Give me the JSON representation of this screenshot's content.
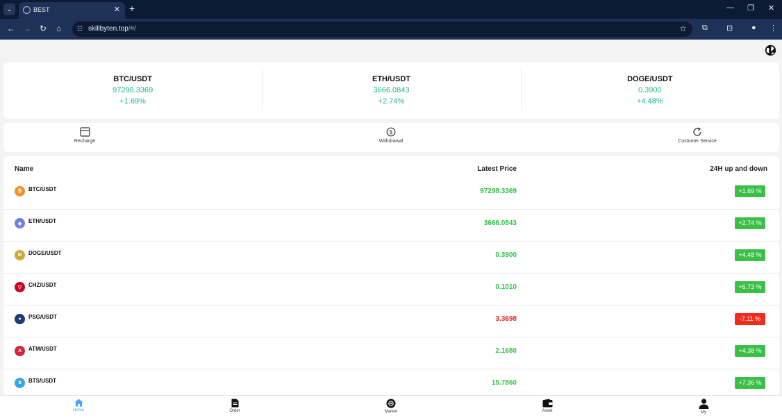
{
  "browser": {
    "tab_title": "BEST",
    "url_host": "skillbyten.top",
    "url_path": "/#/"
  },
  "tickers": [
    {
      "symbol": "BTC/USDT",
      "price": "97298.3369",
      "change": "+1.69%"
    },
    {
      "symbol": "ETH/USDT",
      "price": "3666.0843",
      "change": "+2.74%"
    },
    {
      "symbol": "DOGE/USDT",
      "price": "0.3900",
      "change": "+4.48%"
    }
  ],
  "quick_actions": {
    "recharge": "Recharge",
    "withdrawal": "Withdrawal",
    "customer_service": "Customer Service"
  },
  "market_list": {
    "headers": {
      "name": "Name",
      "latest_price": "Latest Price",
      "change_24h": "24H up and down"
    },
    "rows": [
      {
        "pair": "BTC/USDT",
        "price": "97298.3369",
        "change": "+1.69 %",
        "trend": "up",
        "icon": "bitcoin-icon",
        "icon_color": "#f2902f",
        "icon_glyph": "₿"
      },
      {
        "pair": "ETH/USDT",
        "price": "3666.0843",
        "change": "+2.74 %",
        "trend": "up",
        "icon": "ethereum-icon",
        "icon_color": "#6f7fe3",
        "icon_glyph": "◆"
      },
      {
        "pair": "DOGE/USDT",
        "price": "0.3900",
        "change": "+4.48 %",
        "trend": "up",
        "icon": "dogecoin-icon",
        "icon_color": "#c9a93b",
        "icon_glyph": "Đ"
      },
      {
        "pair": "CHZ/USDT",
        "price": "0.1010",
        "change": "+6.73 %",
        "trend": "up",
        "icon": "chiliz-icon",
        "icon_color": "#cd0124",
        "icon_glyph": "▽"
      },
      {
        "pair": "PSG/USDT",
        "price": "3.3698",
        "change": "-7.11 %",
        "trend": "down",
        "icon": "psg-icon",
        "icon_color": "#1f3b7a",
        "icon_glyph": "●"
      },
      {
        "pair": "ATM/USDT",
        "price": "2.1680",
        "change": "+4.38 %",
        "trend": "up",
        "icon": "atletico-icon",
        "icon_color": "#d8223a",
        "icon_glyph": "A"
      },
      {
        "pair": "BTS/USDT",
        "price": "15.7860",
        "change": "+7.36 %",
        "trend": "up",
        "icon": "bitshares-icon",
        "icon_color": "#35a7e0",
        "icon_glyph": "b"
      }
    ]
  },
  "colors": {
    "up_text": "#33c14a",
    "up_badge": "#3cbf48",
    "down_text": "#ee2222",
    "down_badge": "#f32a1e",
    "ticker_accent": "#1bb58f",
    "active_tab": "#4aa3ff"
  },
  "bottom_nav": [
    {
      "label": "Home",
      "icon": "home-icon",
      "active": true
    },
    {
      "label": "Order",
      "icon": "document-icon",
      "active": false
    },
    {
      "label": "Market",
      "icon": "market-icon",
      "active": false
    },
    {
      "label": "Asset",
      "icon": "wallet-icon",
      "active": false
    },
    {
      "label": "My",
      "icon": "user-icon",
      "active": false
    }
  ]
}
